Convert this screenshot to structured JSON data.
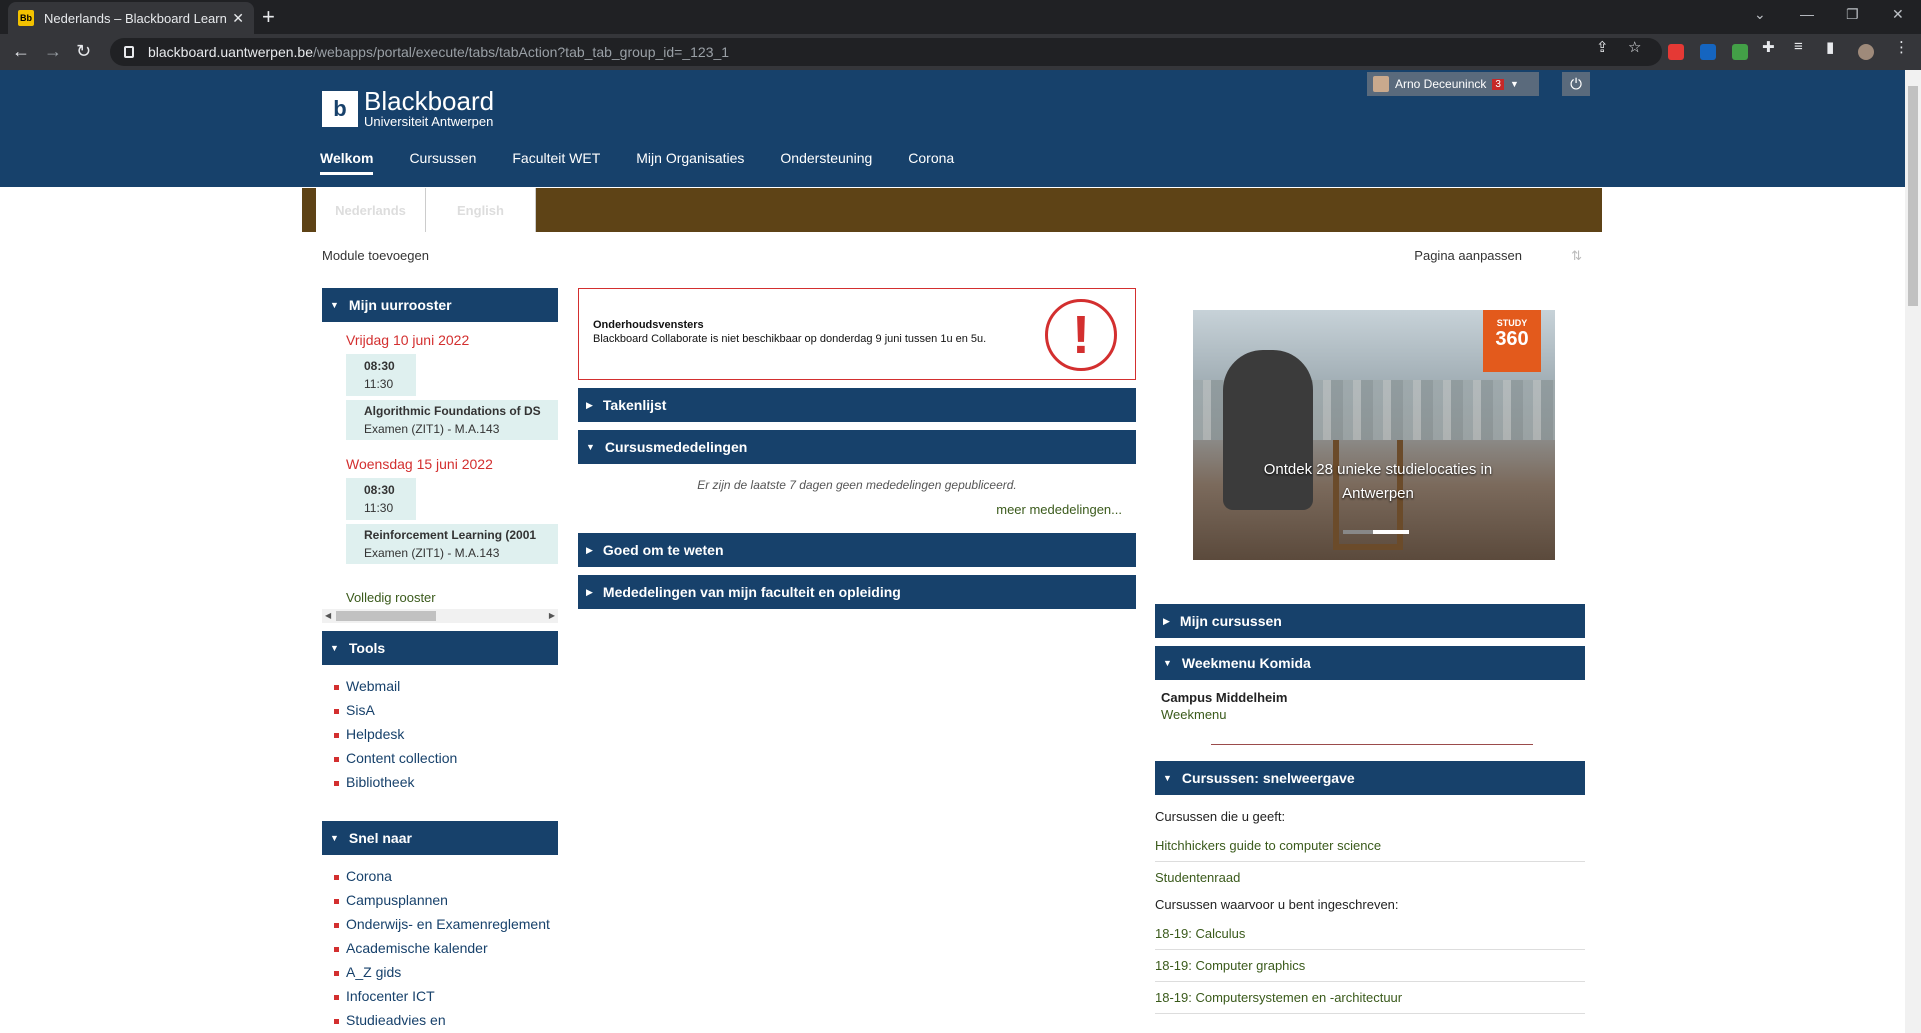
{
  "browser": {
    "tab_title": "Nederlands – Blackboard Learn",
    "favicon_text": "Bb",
    "url_host": "blackboard.uantwerpen.be",
    "url_path": "/webapps/portal/execute/tabs/tabAction?tab_tab_group_id=_123_1"
  },
  "header": {
    "brand": "Blackboard",
    "subtitle": "Universiteit Antwerpen",
    "user_name": "Arno Deceuninck",
    "notification_count": "3",
    "nav": [
      "Welkom",
      "Cursussen",
      "Faculteit WET",
      "Mijn Organisaties",
      "Ondersteuning",
      "Corona"
    ]
  },
  "lang_tabs": [
    "Nederlands",
    "English"
  ],
  "page_actions": {
    "add_module": "Module toevoegen",
    "customize": "Pagina aanpassen"
  },
  "uurrooster": {
    "title": "Mijn uurrooster",
    "entries": [
      {
        "date": "Vrijdag 10 juni 2022",
        "start": "08:30",
        "end": "11:30",
        "course": "Algorithmic Foundations of DS",
        "detail": "Examen (ZIT1) - M.A.143"
      },
      {
        "date": "Woensdag 15 juni 2022",
        "start": "08:30",
        "end": "11:30",
        "course": "Reinforcement Learning (2001",
        "detail": "Examen (ZIT1) - M.A.143"
      }
    ],
    "full_schedule": "Volledig rooster"
  },
  "tools": {
    "title": "Tools",
    "items": [
      "Webmail",
      "SisA",
      "Helpdesk",
      "Content collection",
      "Bibliotheek"
    ]
  },
  "snel_naar": {
    "title": "Snel naar",
    "items": [
      "Corona",
      "Campusplannen",
      "Onderwijs- en Examenreglement",
      "Academische kalender",
      "A_Z gids",
      "Infocenter ICT",
      "Studieadvies en"
    ]
  },
  "maintenance": {
    "title": "Onderhoudsvensters",
    "text": "Blackboard Collaborate is niet beschikbaar op donderdag 9 juni tussen 1u en 5u."
  },
  "middle_modules": {
    "takenlijst": "Takenlijst",
    "cursusmededelingen": "Cursusmededelingen",
    "no_announcements": "Er zijn de laatste 7 dagen geen mededelingen gepubliceerd.",
    "more_announcements": "meer mededelingen...",
    "goed_om_te_weten": "Goed om te weten",
    "faculteit": "Mededelingen van mijn faculteit en opleiding"
  },
  "promo": {
    "badge_top": "STUDY",
    "badge_num": "360",
    "caption": "Ontdek 28 unieke studielocaties in Antwerpen"
  },
  "right_modules": {
    "mijn_cursussen": "Mijn cursussen",
    "weekmenu": "Weekmenu Komida",
    "campus": "Campus Middelheim",
    "weekmenu_link": "Weekmenu",
    "snelweergave": "Cursussen: snelweergave",
    "given_label": "Cursussen die u geeft:",
    "given": [
      "Hitchhickers guide to computer science",
      "Studentenraad"
    ],
    "enrolled_label": "Cursussen waarvoor u bent ingeschreven:",
    "enrolled": [
      "18-19: Calculus",
      "18-19: Computer graphics",
      "18-19: Computersystemen en -architectuur"
    ]
  }
}
